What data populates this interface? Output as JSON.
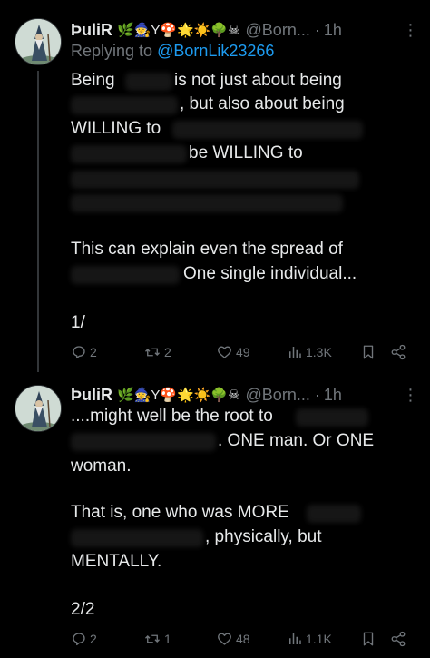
{
  "tweets": [
    {
      "display_name": "ÞuliR",
      "emojis": "🌿🧙Y🍄🌟☀️🌳☠",
      "handle": "@Born...",
      "dot": "·",
      "time": "1h",
      "replying_prefix": "Replying to",
      "replying_handle": "@BornLik23266",
      "lines": [
        "Being",
        "is not just about being",
        ", but also about being",
        "WILLING to",
        "be WILLING to",
        "This can explain even the spread of",
        "One single individual...",
        "1/"
      ],
      "stats": {
        "replies": "2",
        "retweets": "2",
        "likes": "49",
        "views": "1.3K"
      }
    },
    {
      "display_name": "ÞuliR",
      "emojis": "🌿🧙Y🍄🌟☀️🌳☠",
      "handle": "@Born...",
      "dot": "·",
      "time": "1h",
      "lines": [
        "....might well be the root to",
        ". ONE man. Or ONE",
        "woman.",
        "That is, one who was MORE",
        ", physically, but",
        "MENTALLY.",
        "2/2"
      ],
      "stats": {
        "replies": "2",
        "retweets": "1",
        "likes": "48",
        "views": "1.1K"
      }
    }
  ],
  "colors": {
    "background": "#000000",
    "text": "#e7e9ea",
    "muted": "#71767b",
    "link": "#1d9bf0"
  },
  "icons": [
    "more-icon",
    "reply-icon",
    "retweet-icon",
    "like-icon",
    "views-icon",
    "bookmark-icon",
    "share-icon"
  ]
}
